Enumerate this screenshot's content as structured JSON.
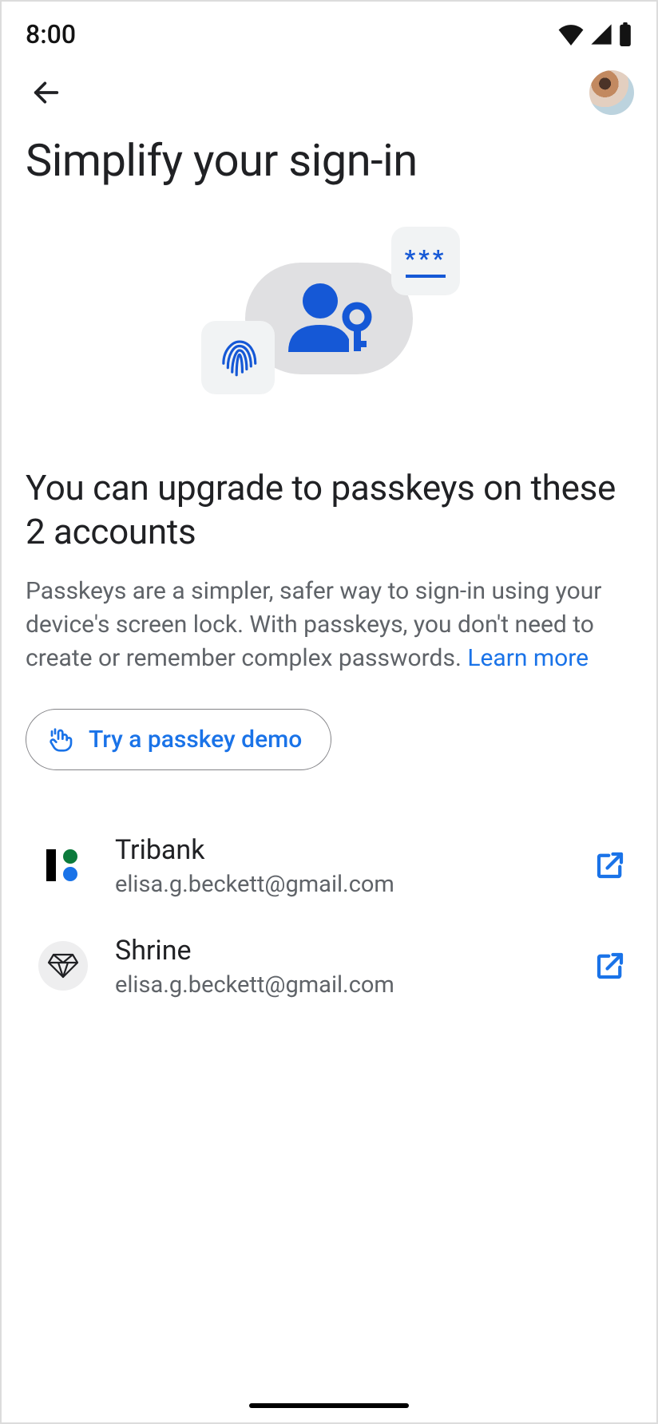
{
  "status": {
    "time": "8:00"
  },
  "header": {
    "title": "Simplify your sign-in"
  },
  "section": {
    "heading": "You can upgrade to passkeys on these 2 accounts",
    "description": "Passkeys are a simpler, safer way to sign-in using your device's screen lock. With passkeys, you don't need to create or remember complex passwords. ",
    "learn_more": "Learn more"
  },
  "demo_button": {
    "label": "Try a passkey demo"
  },
  "accounts": [
    {
      "name": "Tribank",
      "email": "elisa.g.beckett@gmail.com",
      "logo": "tribank"
    },
    {
      "name": "Shrine",
      "email": "elisa.g.beckett@gmail.com",
      "logo": "shrine"
    }
  ],
  "colors": {
    "accent": "#1a73e8",
    "text": "#202124",
    "muted": "#5f6368"
  }
}
